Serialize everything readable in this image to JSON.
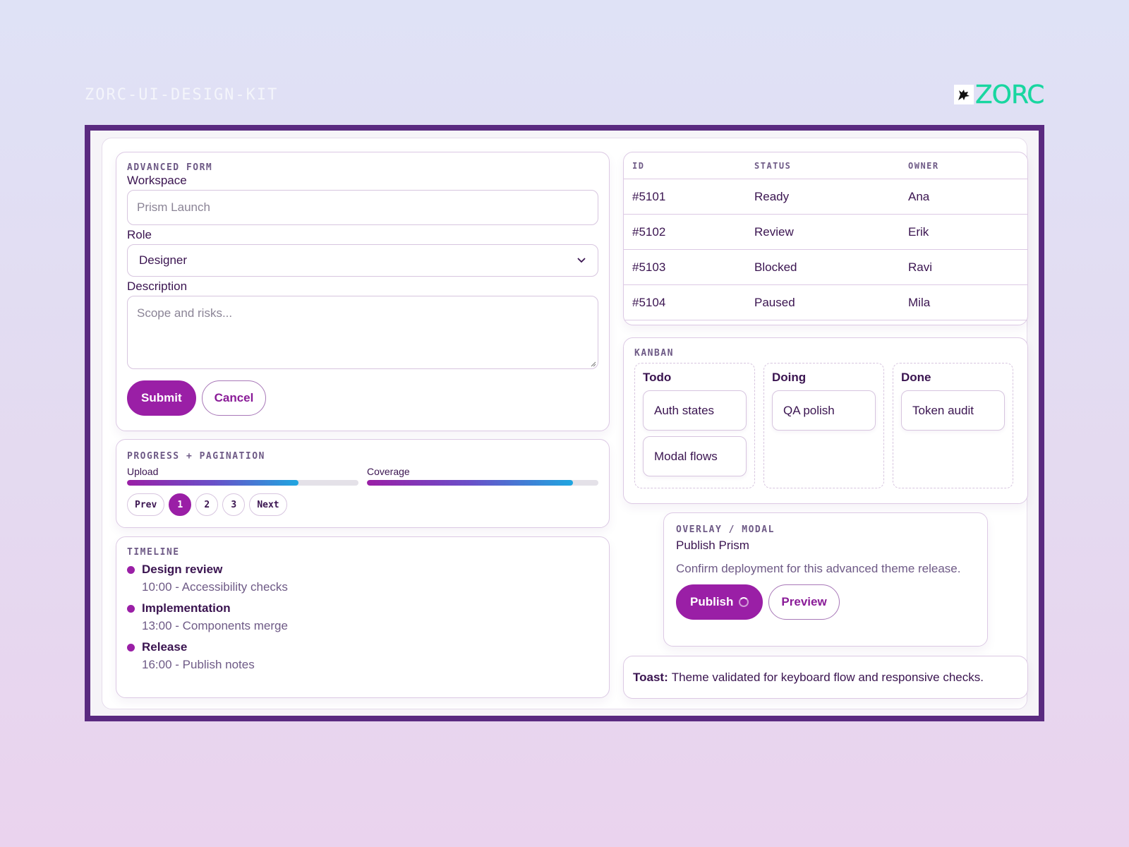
{
  "header": {
    "kit_title": "ZORC-UI-DESIGN-KIT",
    "brand_name": "ZORC",
    "brand_color": "#19d6a0",
    "accent_color": "#9a1fa6",
    "frame_color": "#5a2a80"
  },
  "form": {
    "section_label": "ADVANCED FORM",
    "workspace_label": "Workspace",
    "workspace_placeholder": "Prism Launch",
    "role_label": "Role",
    "role_value": "Designer",
    "description_label": "Description",
    "description_placeholder": "Scope and risks...",
    "submit_label": "Submit",
    "cancel_label": "Cancel"
  },
  "progress": {
    "section_label": "PROGRESS + PAGINATION",
    "bars": [
      {
        "label": "Upload",
        "percent": 74
      },
      {
        "label": "Coverage",
        "percent": 89
      }
    ],
    "pagination": {
      "prev": "Prev",
      "pages": [
        "1",
        "2",
        "3"
      ],
      "active": "1",
      "next": "Next"
    }
  },
  "timeline": {
    "section_label": "TIMELINE",
    "items": [
      {
        "title": "Design review",
        "detail": "10:00 - Accessibility checks"
      },
      {
        "title": "Implementation",
        "detail": "13:00 - Components merge"
      },
      {
        "title": "Release",
        "detail": "16:00 - Publish notes"
      }
    ]
  },
  "table": {
    "headers": [
      "ID",
      "STATUS",
      "OWNER"
    ],
    "rows": [
      [
        "#5101",
        "Ready",
        "Ana"
      ],
      [
        "#5102",
        "Review",
        "Erik"
      ],
      [
        "#5103",
        "Blocked",
        "Ravi"
      ],
      [
        "#5104",
        "Paused",
        "Mila"
      ]
    ]
  },
  "kanban": {
    "section_label": "KANBAN",
    "columns": [
      {
        "title": "Todo",
        "cards": [
          "Auth states",
          "Modal flows"
        ]
      },
      {
        "title": "Doing",
        "cards": [
          "QA polish"
        ]
      },
      {
        "title": "Done",
        "cards": [
          "Token audit"
        ]
      }
    ]
  },
  "modal": {
    "section_label": "OVERLAY / MODAL",
    "title": "Publish Prism",
    "text": "Confirm deployment for this advanced theme release.",
    "publish_label": "Publish",
    "preview_label": "Preview"
  },
  "toast": {
    "label": "Toast:",
    "message": "Theme validated for keyboard flow and responsive checks."
  }
}
